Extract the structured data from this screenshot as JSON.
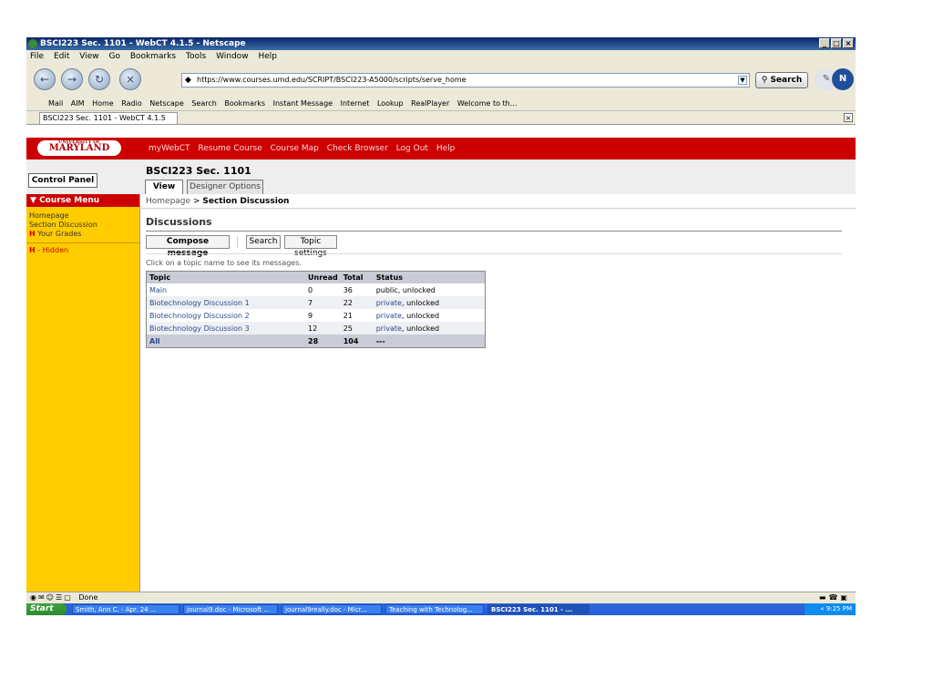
{
  "window": {
    "title": "BSCI223 Sec. 1101 - WebCT 4.1.5 - Netscape",
    "min": "_",
    "max": "□",
    "close": "×"
  },
  "menu": [
    "File",
    "Edit",
    "View",
    "Go",
    "Bookmarks",
    "Tools",
    "Window",
    "Help"
  ],
  "nav": {
    "url": "https://www.courses.umd.edu/SCRIPT/BSCI223-A5000/scripts/serve_home",
    "search_label": "Search",
    "back_glyph": "←",
    "forward_glyph": "→",
    "reload_glyph": "↻",
    "stop_glyph": "×",
    "throbber_glyph": "N"
  },
  "personal_toolbar": [
    "Mail",
    "AIM",
    "Home",
    "Radio",
    "Netscape",
    "Search",
    "Bookmarks",
    "Instant Message",
    "Internet",
    "Lookup",
    "RealPlayer",
    "Welcome to th..."
  ],
  "tab": {
    "label": "BSCI223 Sec. 1101 - WebCT 4.1.5",
    "close": "×"
  },
  "header": {
    "logo_top": "UNIVERSITY OF",
    "logo_main": "MARYLAND",
    "links": [
      "myWebCT",
      "Resume Course",
      "Course Map",
      "Check Browser",
      "Log Out",
      "Help"
    ]
  },
  "control_panel": "Control Panel",
  "course_title": "BSCI223 Sec. 1101",
  "view_tabs": {
    "view": "View",
    "designer": "Designer Options"
  },
  "sidebar": {
    "menu_title": "Course Menu",
    "items": [
      "Homepage",
      "Section Discussion",
      "Your Grades"
    ],
    "hidden_marker": "H",
    "hidden_legend": "- Hidden"
  },
  "breadcrumb": {
    "home": "Homepage",
    "sep": ">",
    "current": "Section Discussion"
  },
  "page_title": "Discussions",
  "buttons": {
    "compose": "Compose message",
    "search": "Search",
    "topic_settings": "Topic settings"
  },
  "hint": "Click on a topic name to see its messages.",
  "table": {
    "headers": [
      "Topic",
      "Unread",
      "Total",
      "Status"
    ],
    "rows": [
      {
        "topic": "Main",
        "unread": "0",
        "total": "36",
        "status_a": "public",
        "status_b": ", unlocked"
      },
      {
        "topic": "Biotechnology Discussion 1",
        "unread": "7",
        "total": "22",
        "status_a": "private",
        "status_b": ", unlocked"
      },
      {
        "topic": "Biotechnology Discussion 2",
        "unread": "9",
        "total": "21",
        "status_a": "private",
        "status_b": ", unlocked"
      },
      {
        "topic": "Biotechnology Discussion 3",
        "unread": "12",
        "total": "25",
        "status_a": "private",
        "status_b": ", unlocked"
      }
    ],
    "total_row": {
      "topic": "All",
      "unread": "28",
      "total": "104",
      "status": "---"
    }
  },
  "status": "Done",
  "taskbar": {
    "start": "Start",
    "tasks": [
      "Smith, Ann C. - Apr. 24 ...",
      "journal9.doc - Microsoft ...",
      "journal9really.doc - Micr...",
      "Teaching with Technolog...",
      "BSCI223 Sec. 1101 - ..."
    ],
    "clock": "9:25 PM",
    "tray_chevron": "«"
  }
}
